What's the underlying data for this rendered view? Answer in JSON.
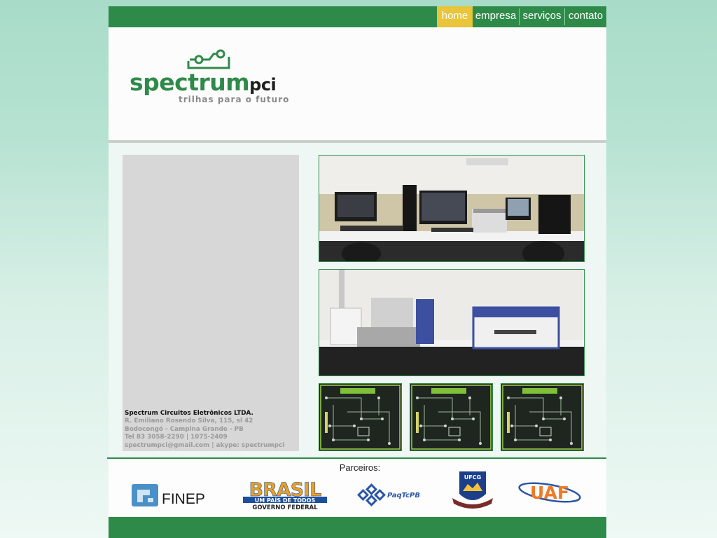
{
  "nav": {
    "items": [
      {
        "label": "home",
        "active": true
      },
      {
        "label": "empresa",
        "active": false
      },
      {
        "label": "serviços",
        "active": false
      },
      {
        "label": "contato",
        "active": false
      }
    ]
  },
  "logo": {
    "name_main": "spectrum",
    "name_suffix": "pci",
    "tagline": "trilhas para o futuro"
  },
  "company": {
    "name": "Spectrum Circuitos Eletrônicos LTDA.",
    "address": "R. Emiliano Rosendo Silva, 115, sl 42",
    "district": "Bodocongó - Campina Grande - PB",
    "phone": "Tel 83 3058-2290 | 1075-2409",
    "contact": "spectrumpci@gmail.com  |  akype: spectrumpci"
  },
  "partners": {
    "title": "Parceiros:",
    "finep": "FINEP",
    "brasil_top": "BRASIL",
    "brasil_mid": "UM PAÍS DE TODOS",
    "brasil_bottom": "GOVERNO FEDERAL",
    "paqtc": "PaqTcPB",
    "ufcg": "UFCG",
    "uaf": "UAF"
  },
  "colors": {
    "brand_green": "#2e8a49",
    "nav_active": "#e8c53a"
  }
}
